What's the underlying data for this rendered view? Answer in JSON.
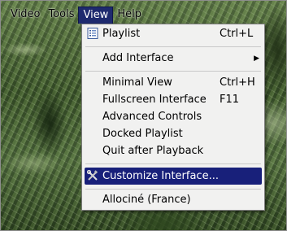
{
  "menubar": {
    "items": [
      {
        "label": "Video",
        "mnemonic": "V"
      },
      {
        "label": "Tools",
        "mnemonic": "T"
      },
      {
        "label": "View",
        "mnemonic": "V",
        "active": true
      },
      {
        "label": "Help",
        "mnemonic": "H"
      }
    ]
  },
  "view_menu": {
    "items": [
      {
        "label": "Playlist",
        "shortcut": "Ctrl+L",
        "icon": "playlist-icon"
      },
      {
        "label": "Add Interface",
        "submenu": true
      },
      {
        "label": "Minimal View",
        "shortcut": "Ctrl+H"
      },
      {
        "label": "Fullscreen Interface",
        "shortcut": "F11"
      },
      {
        "label": "Advanced Controls"
      },
      {
        "label": "Docked Playlist"
      },
      {
        "label": "Quit after Playback"
      },
      {
        "label": "Customize Interface...",
        "icon": "tools-icon",
        "highlighted": true
      },
      {
        "label": "Allociné (France)"
      }
    ],
    "submenu_arrow": "▶"
  },
  "colors": {
    "highlight": "#18207a",
    "menu_bg": "#f1f1f0"
  }
}
